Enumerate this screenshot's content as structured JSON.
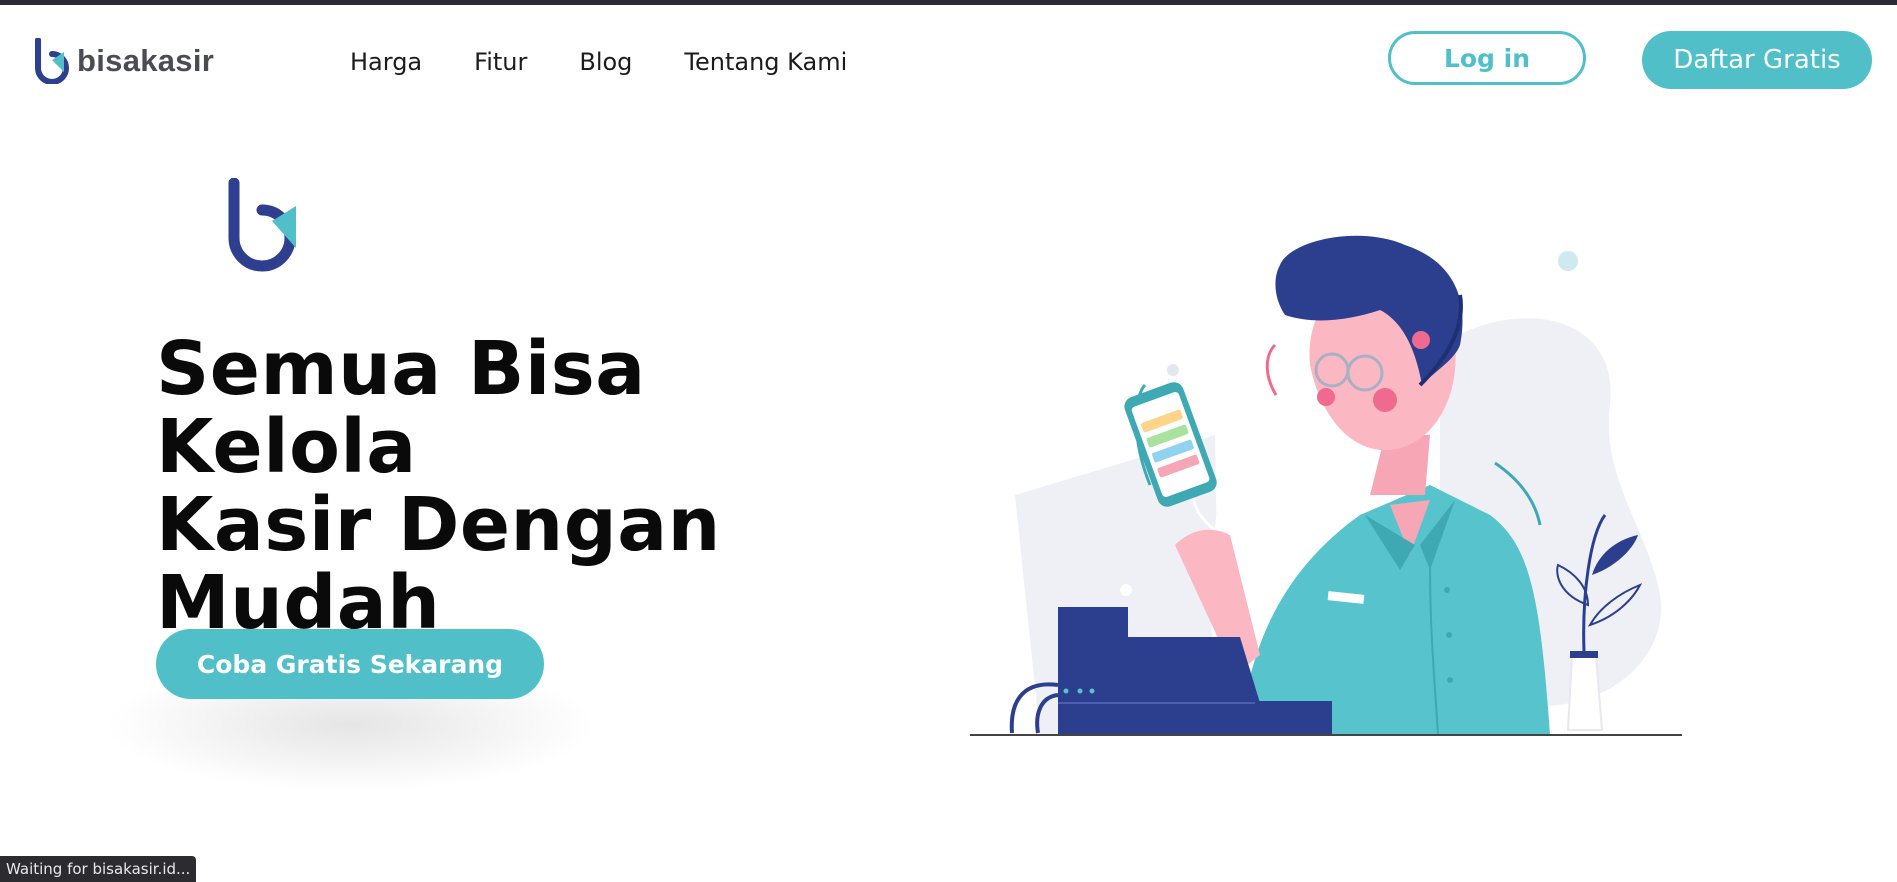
{
  "brand": {
    "name": "bisakasir",
    "primary_color": "#50bfc8",
    "logo_blue": "#2e3f8f"
  },
  "nav": {
    "items": [
      "Harga",
      "Fitur",
      "Blog",
      "Tentang Kami"
    ],
    "login_label": "Log in",
    "signup_label": "Daftar Gratis"
  },
  "hero": {
    "title_lines": [
      "Semua Bisa Kelola",
      "Kasir Dengan",
      "Mudah"
    ],
    "cta_label": "Coba Gratis Sekarang",
    "illustration": "man-with-phone-at-cash-register"
  },
  "status_bar": {
    "text": "Waiting for bisakasir.id..."
  }
}
